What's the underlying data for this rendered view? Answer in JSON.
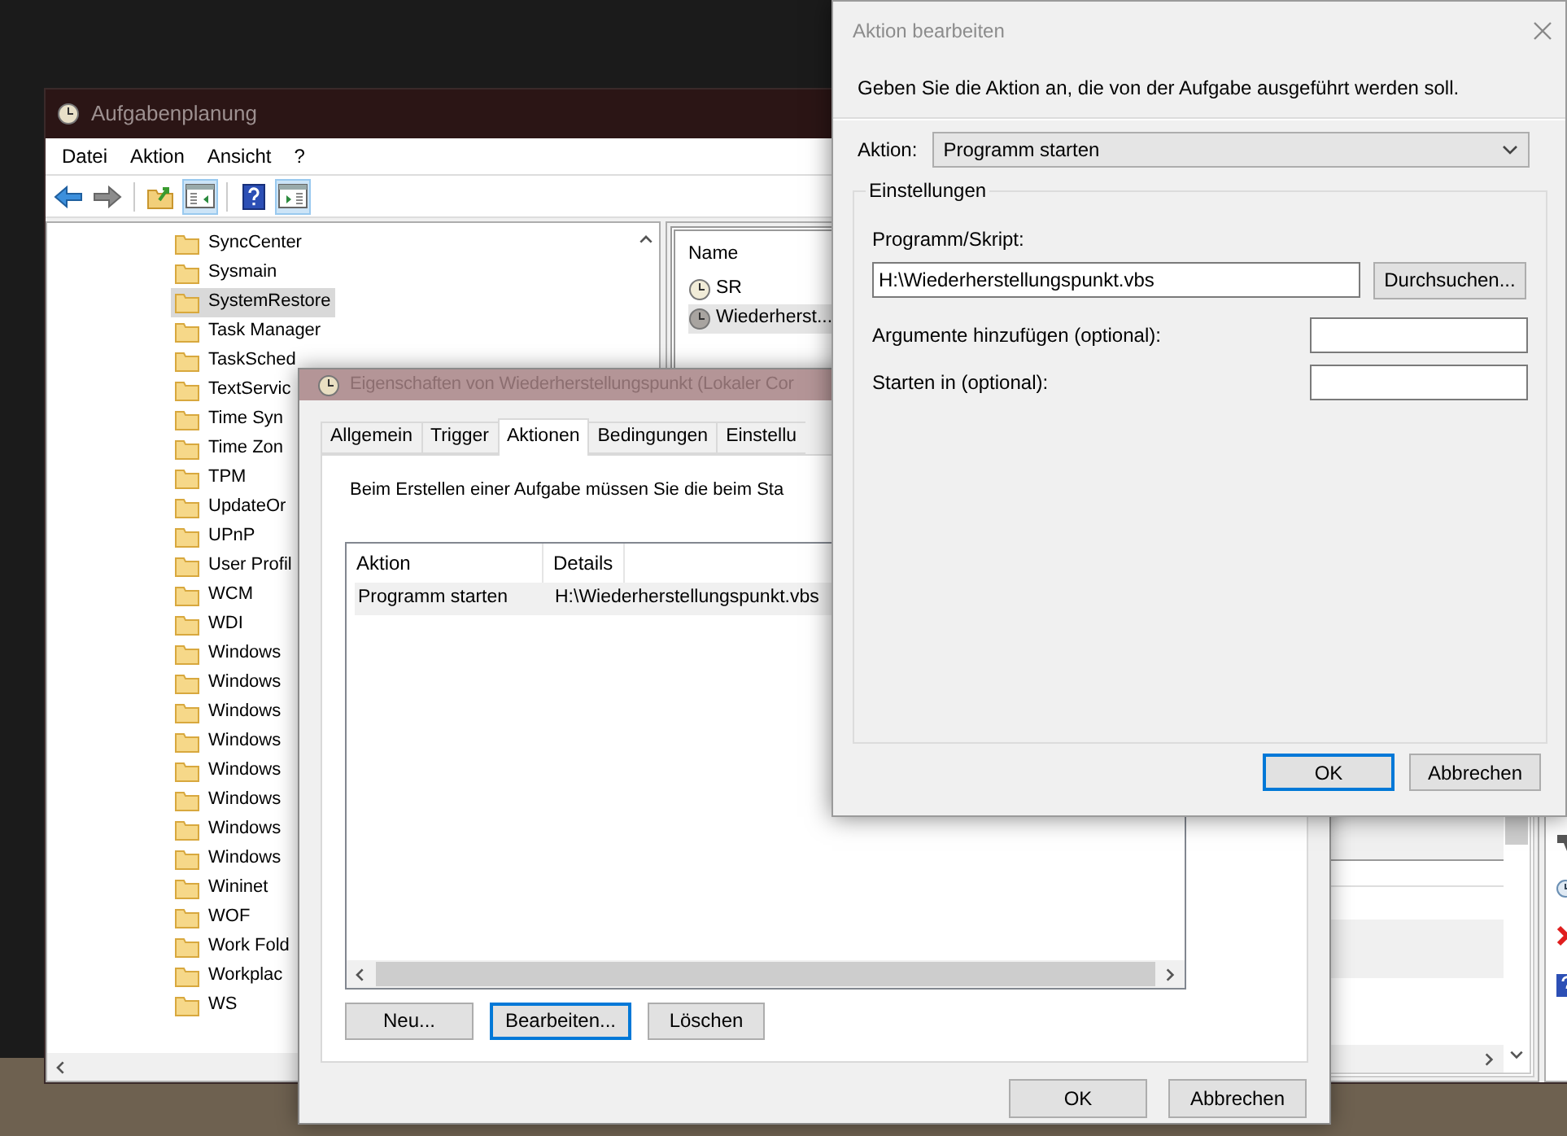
{
  "main_window": {
    "title": "Aufgabenplanung",
    "menu": [
      "Datei",
      "Aktion",
      "Ansicht",
      "?"
    ],
    "toolbar": [
      [
        {
          "kind": "back",
          "pressed": false
        },
        {
          "kind": "forward",
          "pressed": false
        }
      ],
      [
        {
          "kind": "folder-up",
          "pressed": false
        },
        {
          "kind": "pane-left",
          "pressed": true
        }
      ],
      [
        {
          "kind": "help",
          "pressed": false
        },
        {
          "kind": "pane-right",
          "pressed": true
        }
      ]
    ],
    "tree_items": [
      {
        "label": "SyncCenter",
        "selected": false
      },
      {
        "label": "Sysmain",
        "selected": false
      },
      {
        "label": "SystemRestore",
        "selected": true
      },
      {
        "label": "Task Manager",
        "selected": false
      },
      {
        "label": "TaskSched",
        "selected": false
      },
      {
        "label": "TextServic",
        "selected": false
      },
      {
        "label": "Time Syn",
        "selected": false
      },
      {
        "label": "Time Zon",
        "selected": false
      },
      {
        "label": "TPM",
        "selected": false
      },
      {
        "label": "UpdateOr",
        "selected": false
      },
      {
        "label": "UPnP",
        "selected": false
      },
      {
        "label": "User Profil",
        "selected": false
      },
      {
        "label": "WCM",
        "selected": false
      },
      {
        "label": "WDI",
        "selected": false
      },
      {
        "label": "Windows",
        "selected": false
      },
      {
        "label": "Windows",
        "selected": false
      },
      {
        "label": "Windows",
        "selected": false
      },
      {
        "label": "Windows",
        "selected": false
      },
      {
        "label": "Windows",
        "selected": false
      },
      {
        "label": "Windows",
        "selected": false
      },
      {
        "label": "Windows",
        "selected": false
      },
      {
        "label": "Windows",
        "selected": false
      },
      {
        "label": "Wininet",
        "selected": false
      },
      {
        "label": "WOF",
        "selected": false
      },
      {
        "label": "Work Fold",
        "selected": false
      },
      {
        "label": "Workplac",
        "selected": false
      },
      {
        "label": "WS",
        "selected": false
      }
    ],
    "task_list": {
      "column": "Name",
      "items": [
        {
          "label": "SR",
          "selected": false
        },
        {
          "label": "Wiederherst...",
          "selected": true
        }
      ]
    }
  },
  "properties_dialog": {
    "title": "Eigenschaften von Wiederherstellungspunkt (Lokaler Cor",
    "tabs": [
      {
        "label": "Allgemein",
        "selected": false
      },
      {
        "label": "Trigger",
        "selected": false
      },
      {
        "label": "Aktionen",
        "selected": true
      },
      {
        "label": "Bedingungen",
        "selected": false
      },
      {
        "label": "Einstellu",
        "selected": false
      }
    ],
    "description": "Beim Erstellen einer Aufgabe müssen Sie die beim Sta",
    "table": {
      "columns": [
        "Aktion",
        "Details"
      ],
      "rows": [
        {
          "cells": [
            "Programm starten",
            "H:\\Wiederherstellungspunkt.vbs"
          ],
          "selected": true
        }
      ]
    },
    "buttons": [
      {
        "label": "Neu...",
        "focused": false
      },
      {
        "label": "Bearbeiten...",
        "focused": true
      },
      {
        "label": "Löschen",
        "focused": false
      }
    ],
    "footer_buttons": [
      {
        "label": "OK",
        "focused": false
      },
      {
        "label": "Abbrechen",
        "focused": false
      }
    ]
  },
  "edit_dialog": {
    "title": "Aktion bearbeiten",
    "instruction": "Geben Sie die Aktion an, die von der Aufgabe ausgeführt werden soll.",
    "action_label": "Aktion:",
    "action_value": "Programm starten",
    "group_label": "Einstellungen",
    "fields": [
      {
        "kind": "wide",
        "label": "Programm/Skript:",
        "value": "H:\\Wiederherstellungspunkt.vbs",
        "button": "Durchsuchen..."
      },
      {
        "kind": "inline",
        "label": "Argumente hinzufügen (optional):"
      },
      {
        "kind": "inline",
        "label": "Starten in (optional):"
      }
    ],
    "buttons": [
      {
        "label": "OK",
        "focused": true
      },
      {
        "label": "Abbrechen",
        "focused": false
      }
    ]
  }
}
